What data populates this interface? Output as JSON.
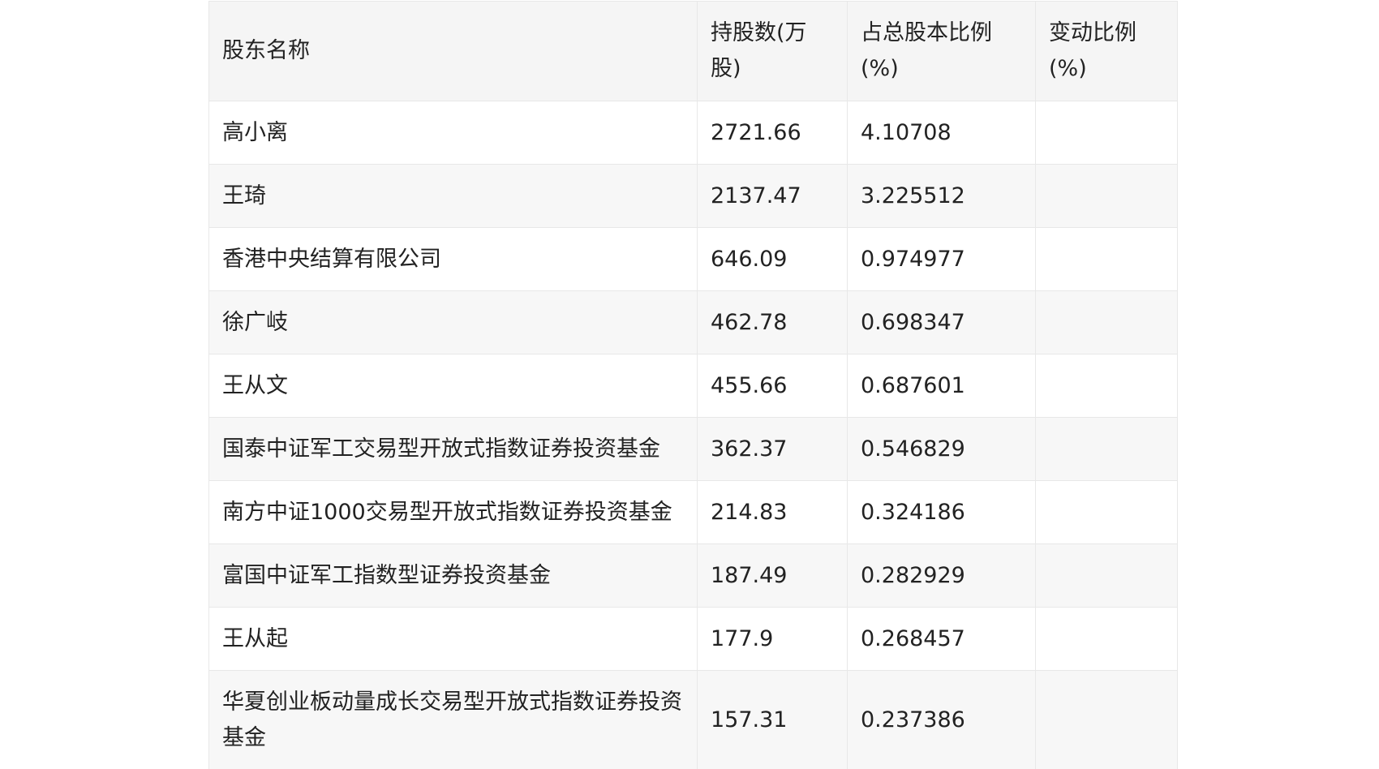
{
  "table": {
    "headers": [
      "股东名称",
      "持股数(万股)",
      "占总股本比例(%)",
      "变动比例(%)"
    ],
    "rows": [
      {
        "name": "高小离",
        "shares": "2721.66",
        "ratio": "4.10708",
        "change": ""
      },
      {
        "name": "王琦",
        "shares": "2137.47",
        "ratio": "3.225512",
        "change": ""
      },
      {
        "name": "香港中央结算有限公司",
        "shares": "646.09",
        "ratio": "0.974977",
        "change": ""
      },
      {
        "name": "徐广岐",
        "shares": "462.78",
        "ratio": "0.698347",
        "change": ""
      },
      {
        "name": "王从文",
        "shares": "455.66",
        "ratio": "0.687601",
        "change": ""
      },
      {
        "name": "国泰中证军工交易型开放式指数证券投资基金",
        "shares": "362.37",
        "ratio": "0.546829",
        "change": ""
      },
      {
        "name": "南方中证1000交易型开放式指数证券投资基金",
        "shares": "214.83",
        "ratio": "0.324186",
        "change": ""
      },
      {
        "name": "富国中证军工指数型证券投资基金",
        "shares": "187.49",
        "ratio": "0.282929",
        "change": ""
      },
      {
        "name": "王从起",
        "shares": "177.9",
        "ratio": "0.268457",
        "change": ""
      },
      {
        "name": "华夏创业板动量成长交易型开放式指数证券投资基金",
        "shares": "157.31",
        "ratio": "0.237386",
        "change": ""
      }
    ]
  }
}
